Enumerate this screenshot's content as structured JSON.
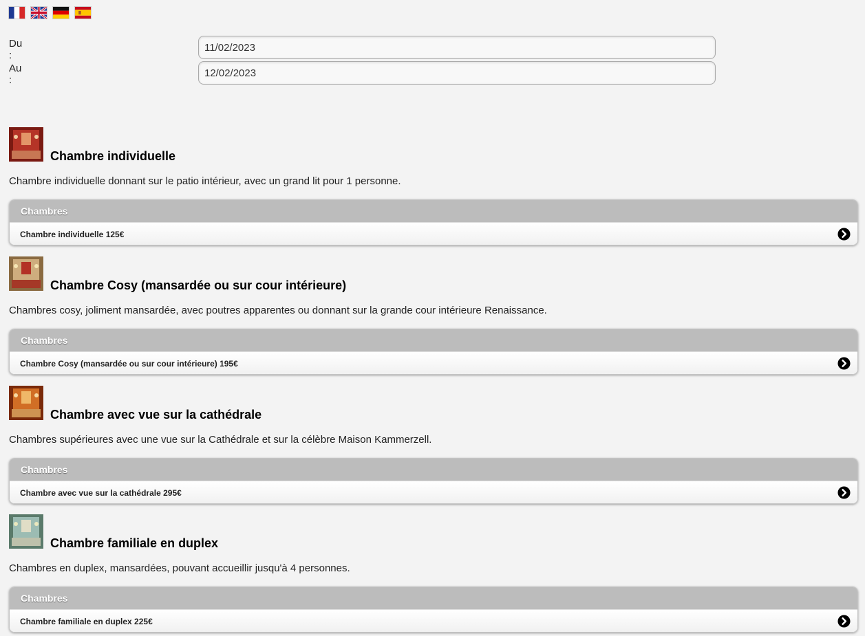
{
  "languages": [
    {
      "code": "fr",
      "icon": "flag-france-icon"
    },
    {
      "code": "en",
      "icon": "flag-uk-icon"
    },
    {
      "code": "de",
      "icon": "flag-germany-icon"
    },
    {
      "code": "es",
      "icon": "flag-spain-icon"
    }
  ],
  "dates": {
    "from_label": "Du :",
    "from_value": "11/02/2023",
    "to_label": "Au :",
    "to_value": "12/02/2023"
  },
  "rooms": [
    {
      "title": "Chambre individuelle",
      "description": "Chambre individuelle donnant sur le patio intérieur, avec un grand lit pour 1 personne.",
      "list_header": "Chambres",
      "item_label": "Chambre individuelle 125€",
      "thumb_colors": [
        "#7a1a12",
        "#c0392b",
        "#e8a070"
      ]
    },
    {
      "title": "Chambre Cosy (mansardée ou sur cour intérieure)",
      "description": "Chambres cosy, joliment mansardée, avec poutres apparentes ou donnant sur la grande cour intérieure Renaissance.",
      "list_header": "Chambres",
      "item_label": "Chambre Cosy (mansardée ou sur cour intérieure) 195€",
      "thumb_colors": [
        "#8a6a40",
        "#d9b98a",
        "#b0231c"
      ]
    },
    {
      "title": "Chambre avec vue sur la cathédrale",
      "description": "Chambres supérieures avec une vue sur la Cathédrale et sur la célèbre Maison Kammerzell.",
      "list_header": "Chambres",
      "item_label": "Chambre avec vue sur la cathédrale 295€",
      "thumb_colors": [
        "#7a2a0a",
        "#e07a2a",
        "#f2c070"
      ]
    },
    {
      "title": "Chambre familiale en duplex",
      "description": "Chambres en duplex, mansardées, pouvant accueillir jusqu'à 4 personnes.",
      "list_header": "Chambres",
      "item_label": "Chambre familiale en duplex 225€",
      "thumb_colors": [
        "#5a7a6a",
        "#a8c8c0",
        "#e8e0c8"
      ]
    }
  ],
  "item_icon": "arrow-right-circle-icon"
}
